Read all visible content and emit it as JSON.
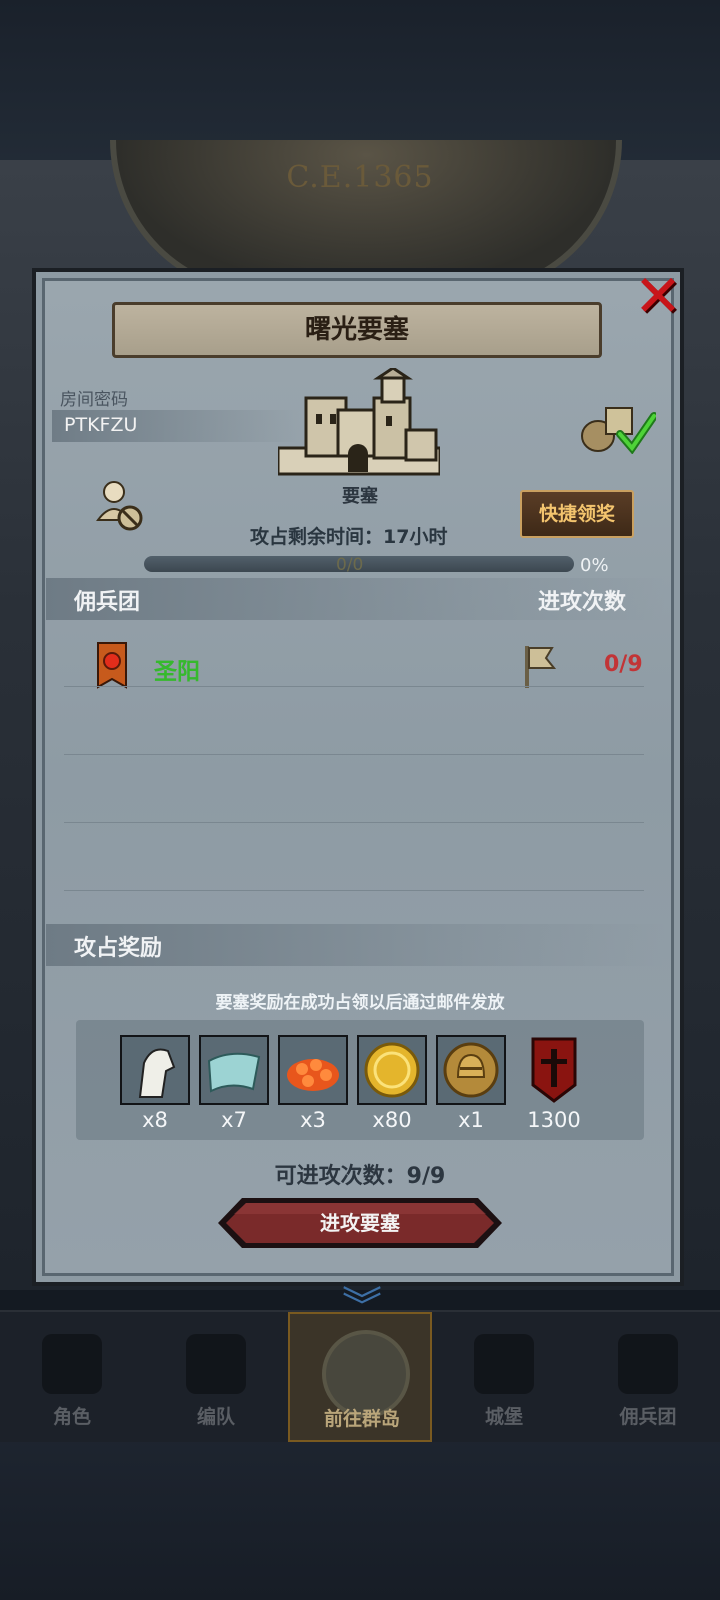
{
  "background": {
    "era_label": "C.E.1365"
  },
  "dialog": {
    "title": "曙光要塞",
    "room_code_label": "房间密码",
    "room_code": "PTKFZU",
    "fortress_label": "要塞",
    "quick_claim_label": "快捷领奖",
    "occupation_time": "攻占剩余时间：17小时",
    "progress_text": "0/0",
    "progress_percent": "0%",
    "progress_fraction": 0,
    "mercenary_header": "佣兵团",
    "attack_count_header": "进攻次数",
    "mercenaries": [
      {
        "name": "圣阳",
        "attacks": "0/9"
      }
    ],
    "reward_header": "攻占奖励",
    "reward_note": "要塞奖励在成功占领以后通过邮件发放",
    "rewards": [
      {
        "icon": "horse-icon",
        "qty": "x8"
      },
      {
        "icon": "cloth-icon",
        "qty": "x7"
      },
      {
        "icon": "ore-icon",
        "qty": "x3"
      },
      {
        "icon": "gold-coin-icon",
        "qty": "x80"
      },
      {
        "icon": "helmet-coin-icon",
        "qty": "x1"
      },
      {
        "icon": "honor-banner-icon",
        "qty": "1300"
      }
    ],
    "attacks_left": "可进攻次数：9/9",
    "attack_button_label": "进攻要塞"
  },
  "nav": [
    {
      "label": "角色",
      "icon": "knight-icon"
    },
    {
      "label": "编队",
      "icon": "armor-icon"
    },
    {
      "label": "前往群岛",
      "icon": "globe-icon",
      "active": true
    },
    {
      "label": "城堡",
      "icon": "castle-icon"
    },
    {
      "label": "佣兵团",
      "icon": "mercenary-icon"
    }
  ],
  "colors": {
    "accent_red": "#c8151a",
    "merc_green": "#36b92d",
    "count_red": "#c23436",
    "gold": "#f3c46e"
  }
}
